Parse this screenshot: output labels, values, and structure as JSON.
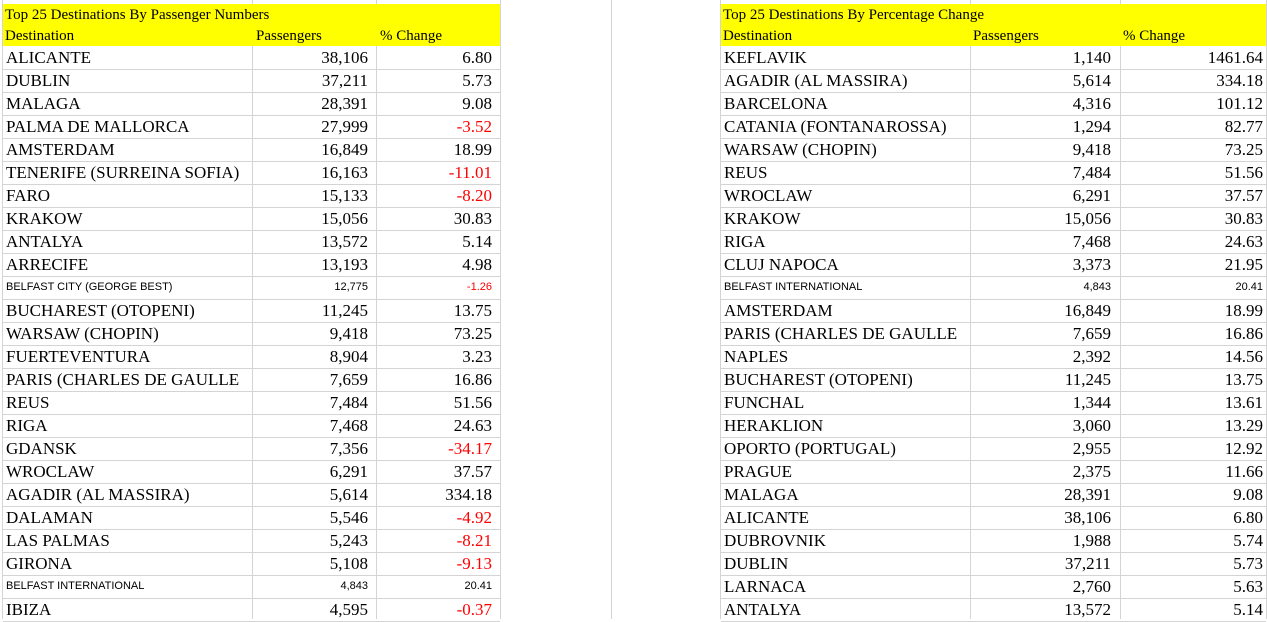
{
  "left": {
    "title": "Top 25 Destinations By Passenger Numbers",
    "headers": {
      "destination": "Destination",
      "passengers": "Passengers",
      "change": "% Change"
    },
    "rows": [
      {
        "dest": "ALICANTE",
        "pax": "38,106",
        "chg": "6.80",
        "neg": false,
        "small": false
      },
      {
        "dest": "DUBLIN",
        "pax": "37,211",
        "chg": "5.73",
        "neg": false,
        "small": false
      },
      {
        "dest": "MALAGA",
        "pax": "28,391",
        "chg": "9.08",
        "neg": false,
        "small": false
      },
      {
        "dest": "PALMA DE MALLORCA",
        "pax": "27,999",
        "chg": "-3.52",
        "neg": true,
        "small": false
      },
      {
        "dest": "AMSTERDAM",
        "pax": "16,849",
        "chg": "18.99",
        "neg": false,
        "small": false
      },
      {
        "dest": "TENERIFE (SURREINA SOFIA)",
        "pax": "16,163",
        "chg": "-11.01",
        "neg": true,
        "small": false
      },
      {
        "dest": "FARO",
        "pax": "15,133",
        "chg": "-8.20",
        "neg": true,
        "small": false
      },
      {
        "dest": "KRAKOW",
        "pax": "15,056",
        "chg": "30.83",
        "neg": false,
        "small": false
      },
      {
        "dest": "ANTALYA",
        "pax": "13,572",
        "chg": "5.14",
        "neg": false,
        "small": false
      },
      {
        "dest": "ARRECIFE",
        "pax": "13,193",
        "chg": "4.98",
        "neg": false,
        "small": false
      },
      {
        "dest": "BELFAST CITY (GEORGE BEST)",
        "pax": "12,775",
        "chg": "-1.26",
        "neg": true,
        "small": true
      },
      {
        "dest": "BUCHAREST (OTOPENI)",
        "pax": "11,245",
        "chg": "13.75",
        "neg": false,
        "small": false
      },
      {
        "dest": "WARSAW (CHOPIN)",
        "pax": "9,418",
        "chg": "73.25",
        "neg": false,
        "small": false
      },
      {
        "dest": "FUERTEVENTURA",
        "pax": "8,904",
        "chg": "3.23",
        "neg": false,
        "small": false
      },
      {
        "dest": "PARIS (CHARLES DE GAULLE",
        "pax": "7,659",
        "chg": "16.86",
        "neg": false,
        "small": false
      },
      {
        "dest": "REUS",
        "pax": "7,484",
        "chg": "51.56",
        "neg": false,
        "small": false
      },
      {
        "dest": "RIGA",
        "pax": "7,468",
        "chg": "24.63",
        "neg": false,
        "small": false
      },
      {
        "dest": "GDANSK",
        "pax": "7,356",
        "chg": "-34.17",
        "neg": true,
        "small": false
      },
      {
        "dest": "WROCLAW",
        "pax": "6,291",
        "chg": "37.57",
        "neg": false,
        "small": false
      },
      {
        "dest": "AGADIR (AL MASSIRA)",
        "pax": "5,614",
        "chg": "334.18",
        "neg": false,
        "small": false
      },
      {
        "dest": "DALAMAN",
        "pax": "5,546",
        "chg": "-4.92",
        "neg": true,
        "small": false
      },
      {
        "dest": "LAS PALMAS",
        "pax": "5,243",
        "chg": "-8.21",
        "neg": true,
        "small": false
      },
      {
        "dest": "GIRONA",
        "pax": "5,108",
        "chg": "-9.13",
        "neg": true,
        "small": false
      },
      {
        "dest": "BELFAST INTERNATIONAL",
        "pax": "4,843",
        "chg": "20.41",
        "neg": false,
        "small": true
      },
      {
        "dest": "IBIZA",
        "pax": "4,595",
        "chg": "-0.37",
        "neg": true,
        "small": false
      }
    ]
  },
  "right": {
    "title": "Top 25 Destinations By Percentage Change",
    "headers": {
      "destination": "Destination",
      "passengers": "Passengers",
      "change": "% Change"
    },
    "rows": [
      {
        "dest": "KEFLAVIK",
        "pax": "1,140",
        "chg": "1461.64",
        "neg": false,
        "small": false
      },
      {
        "dest": "AGADIR (AL MASSIRA)",
        "pax": "5,614",
        "chg": "334.18",
        "neg": false,
        "small": false
      },
      {
        "dest": "BARCELONA",
        "pax": "4,316",
        "chg": "101.12",
        "neg": false,
        "small": false
      },
      {
        "dest": "CATANIA (FONTANAROSSA)",
        "pax": "1,294",
        "chg": "82.77",
        "neg": false,
        "small": false
      },
      {
        "dest": "WARSAW (CHOPIN)",
        "pax": "9,418",
        "chg": "73.25",
        "neg": false,
        "small": false
      },
      {
        "dest": "REUS",
        "pax": "7,484",
        "chg": "51.56",
        "neg": false,
        "small": false
      },
      {
        "dest": "WROCLAW",
        "pax": "6,291",
        "chg": "37.57",
        "neg": false,
        "small": false
      },
      {
        "dest": "KRAKOW",
        "pax": "15,056",
        "chg": "30.83",
        "neg": false,
        "small": false
      },
      {
        "dest": "RIGA",
        "pax": "7,468",
        "chg": "24.63",
        "neg": false,
        "small": false
      },
      {
        "dest": "CLUJ NAPOCA",
        "pax": "3,373",
        "chg": "21.95",
        "neg": false,
        "small": false
      },
      {
        "dest": "BELFAST INTERNATIONAL",
        "pax": "4,843",
        "chg": "20.41",
        "neg": false,
        "small": true
      },
      {
        "dest": "AMSTERDAM",
        "pax": "16,849",
        "chg": "18.99",
        "neg": false,
        "small": false
      },
      {
        "dest": "PARIS (CHARLES DE GAULLE",
        "pax": "7,659",
        "chg": "16.86",
        "neg": false,
        "small": false
      },
      {
        "dest": "NAPLES",
        "pax": "2,392",
        "chg": "14.56",
        "neg": false,
        "small": false
      },
      {
        "dest": "BUCHAREST (OTOPENI)",
        "pax": "11,245",
        "chg": "13.75",
        "neg": false,
        "small": false
      },
      {
        "dest": "FUNCHAL",
        "pax": "1,344",
        "chg": "13.61",
        "neg": false,
        "small": false
      },
      {
        "dest": "HERAKLION",
        "pax": "3,060",
        "chg": "13.29",
        "neg": false,
        "small": false
      },
      {
        "dest": "OPORTO (PORTUGAL)",
        "pax": "2,955",
        "chg": "12.92",
        "neg": false,
        "small": false
      },
      {
        "dest": "PRAGUE",
        "pax": "2,375",
        "chg": "11.66",
        "neg": false,
        "small": false
      },
      {
        "dest": "MALAGA",
        "pax": "28,391",
        "chg": "9.08",
        "neg": false,
        "small": false
      },
      {
        "dest": "ALICANTE",
        "pax": "38,106",
        "chg": "6.80",
        "neg": false,
        "small": false
      },
      {
        "dest": "DUBROVNIK",
        "pax": "1,988",
        "chg": "5.74",
        "neg": false,
        "small": false
      },
      {
        "dest": "DUBLIN",
        "pax": "37,211",
        "chg": "5.73",
        "neg": false,
        "small": false
      },
      {
        "dest": "LARNACA",
        "pax": "2,760",
        "chg": "5.63",
        "neg": false,
        "small": false
      },
      {
        "dest": "ANTALYA",
        "pax": "13,572",
        "chg": "5.14",
        "neg": false,
        "small": false
      }
    ]
  }
}
